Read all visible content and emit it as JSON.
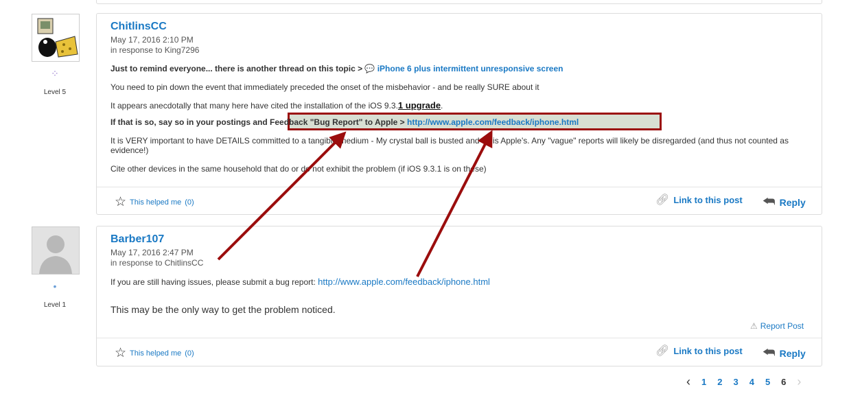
{
  "posts": [
    {
      "author": "ChitlinsCC",
      "date": "May 17, 2016 2:10 PM",
      "in_response": "in response to King7296",
      "level": "Level 5",
      "line1_prefix": "Just to remind everyone... there is another thread on this topic > ",
      "line1_link": "iPhone 6 plus intermittent unresponsive screen",
      "line2": "You need to pin down the event that immediately preceded the onset of the misbehavior - and be really SURE about it",
      "line3_prefix": "It appears anecdotally that many here have cited the installation of the iOS 9.3.",
      "line3_bold": "1 upgrade",
      "line3_suffix": ".",
      "line4_prefix": "If that is so, say so in your postings and ",
      "line4_highlight_text": "Feedback \"Bug Report\" to Apple > ",
      "line4_highlight_link": "http://www.apple.com/feedback/iphone.html",
      "line5": "It is VERY important to have DETAILS committed to a tangible medium - My crystal ball is busted and so is Apple's. Any \"vague\" reports will likely be disregarded (and thus not counted as evidence!)",
      "line6": "Cite other devices in the same household that do or do not exhibit the problem (if iOS 9.3.1 is on these)",
      "helped_label": "This helped me",
      "helped_count": "(0)",
      "link_label": "Link to this post",
      "reply_label": "Reply"
    },
    {
      "author": "Barber107",
      "date": "May 17, 2016 2:47 PM",
      "in_response": "in response to ChitlinsCC",
      "level": "Level 1",
      "line1_prefix": "If you are still having issues, please submit a bug report: ",
      "line1_link": "http://www.apple.com/feedback/iphone.html",
      "line2": "This may be the only way to get the problem noticed.",
      "report_label": "Report Post",
      "helped_label": "This helped me",
      "helped_count": "(0)",
      "link_label": "Link to this post",
      "reply_label": "Reply"
    }
  ],
  "pagination": {
    "pages": [
      "1",
      "2",
      "3",
      "4",
      "5"
    ],
    "current": "6"
  },
  "icons": {
    "star": "star-icon",
    "link": "chain-link-icon",
    "reply": "reply-arrow-icon",
    "warning": "warning-icon",
    "thread": "speech-bubble-icon"
  },
  "colors": {
    "link": "#1a79c4",
    "annotation": "#9b0d0d",
    "highlight_bg": "#d8dfd3"
  }
}
